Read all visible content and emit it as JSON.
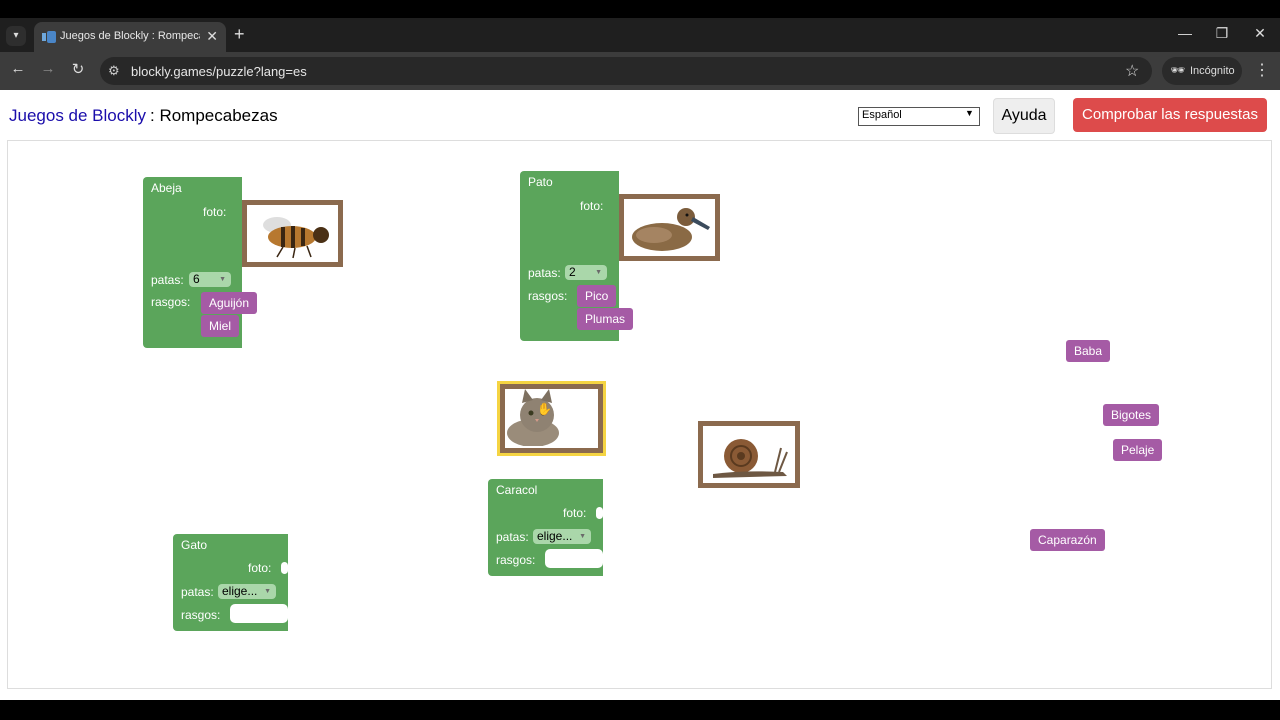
{
  "browser": {
    "tab_title": "Juegos de Blockly : Rompecabe",
    "url": "blockly.games/puzzle?lang=es",
    "incognito_label": "Incógnito"
  },
  "header": {
    "app_link": "Juegos de Blockly",
    "separator_title": ": Rompecabezas",
    "language_selected": "Español",
    "help_label": "Ayuda",
    "check_label": "Comprobar las respuestas"
  },
  "blocks": {
    "abeja": {
      "name": "Abeja",
      "photo_label": "foto:",
      "legs_label": "patas:",
      "legs_value": "6",
      "traits_label": "rasgos:"
    },
    "pato": {
      "name": "Pato",
      "photo_label": "foto:",
      "legs_label": "patas:",
      "legs_value": "2",
      "traits_label": "rasgos:"
    },
    "caracol": {
      "name": "Caracol",
      "photo_label": "foto:",
      "legs_label": "patas:",
      "legs_value": "elige...",
      "traits_label": "rasgos:"
    },
    "gato": {
      "name": "Gato",
      "photo_label": "foto:",
      "legs_label": "patas:",
      "legs_value": "elige...",
      "traits_label": "rasgos:"
    }
  },
  "traits": {
    "aguijon": "Aguijón",
    "miel": "Miel",
    "pico": "Pico",
    "plumas": "Plumas",
    "baba": "Baba",
    "bigotes": "Bigotes",
    "pelaje": "Pelaje",
    "caparazon": "Caparazón"
  },
  "colors": {
    "animal_block": "#5ba55b",
    "trait_block": "#a55ba5",
    "photo_frame": "#8b6a4e",
    "selected_outline": "#f5d442",
    "check_button": "#dd4b4b"
  }
}
